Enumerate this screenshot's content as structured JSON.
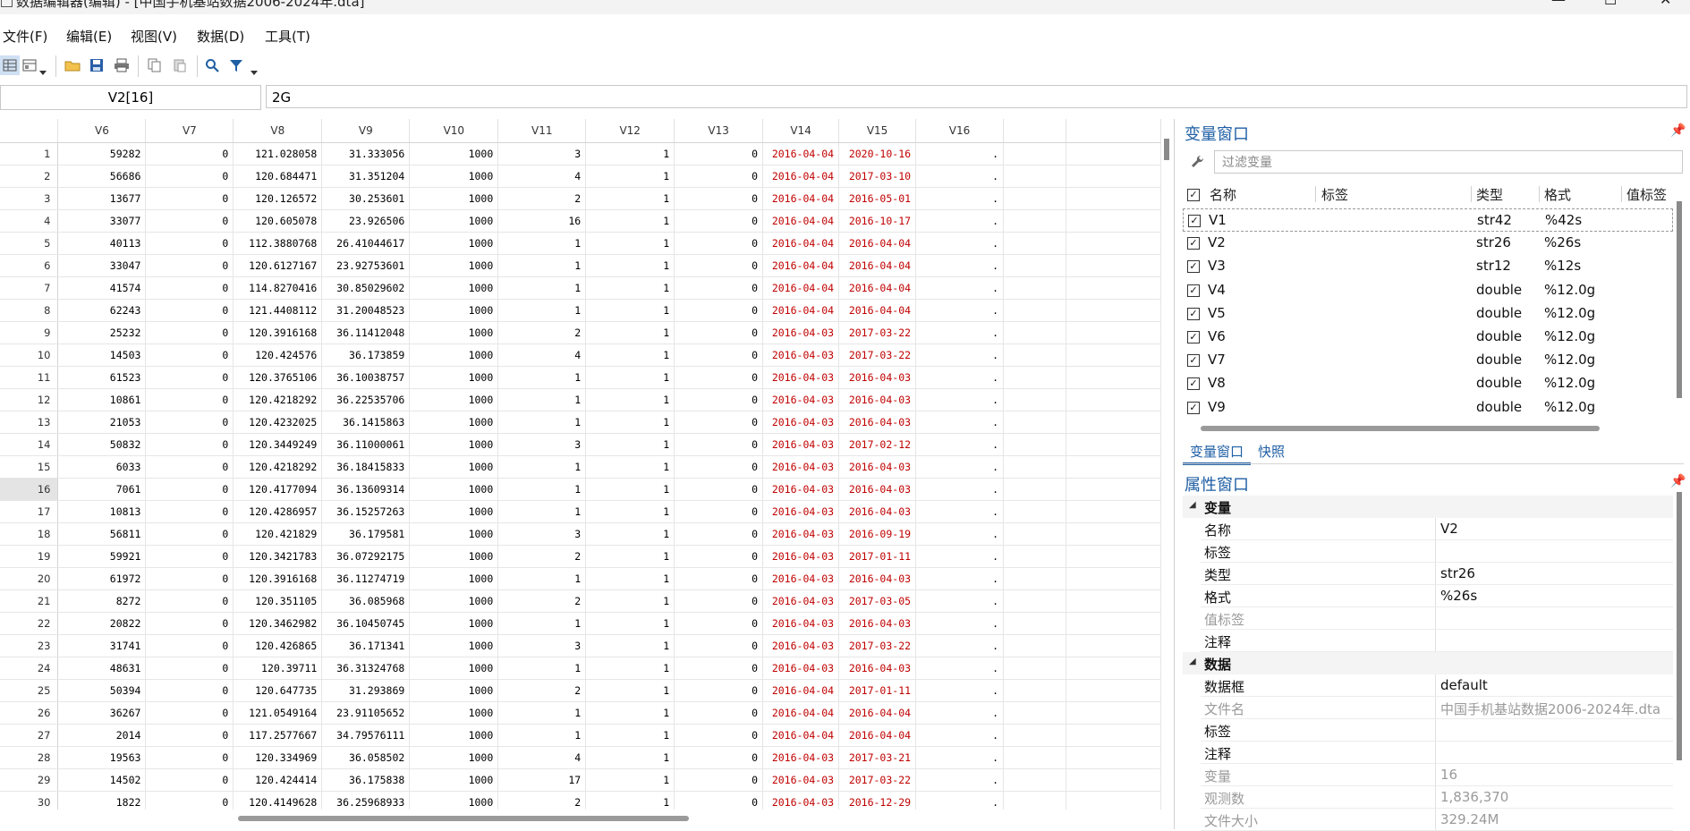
{
  "window": {
    "title": "数据编辑器(编辑) - [中国手机基站数据2006-2024年.dta]",
    "controls": {
      "minimize": "—",
      "maximize": "☐",
      "close": "✕"
    }
  },
  "menu": [
    "文件(F)",
    "编辑(E)",
    "视图(V)",
    "数据(D)",
    "工具(T)"
  ],
  "toolbar_icons": [
    "data-editor-icon",
    "variables-icon",
    "dropdown-arrow-icon",
    "open-folder-icon",
    "save-icon",
    "print-icon",
    "copy-icon",
    "paste-icon",
    "search-icon",
    "filter-icon",
    "dropdown-arrow-icon"
  ],
  "cell_reference": "V2[16]",
  "cell_value": "2G",
  "grid": {
    "columns": [
      "V6",
      "V7",
      "V8",
      "V9",
      "V10",
      "V11",
      "V12",
      "V13",
      "V14",
      "V15",
      "V16"
    ],
    "selected_row": 16,
    "rows": [
      [
        "59282",
        "0",
        "121.028058",
        "31.333056",
        "1000",
        "3",
        "1",
        "0",
        "2016-04-04",
        "2020-10-16",
        "."
      ],
      [
        "56686",
        "0",
        "120.684471",
        "31.351204",
        "1000",
        "4",
        "1",
        "0",
        "2016-04-04",
        "2017-03-10",
        "."
      ],
      [
        "13677",
        "0",
        "120.126572",
        "30.253601",
        "1000",
        "2",
        "1",
        "0",
        "2016-04-04",
        "2016-05-01",
        "."
      ],
      [
        "33077",
        "0",
        "120.605078",
        "23.926506",
        "1000",
        "16",
        "1",
        "0",
        "2016-04-04",
        "2016-10-17",
        "."
      ],
      [
        "40113",
        "0",
        "112.3880768",
        "26.41044617",
        "1000",
        "1",
        "1",
        "0",
        "2016-04-04",
        "2016-04-04",
        "."
      ],
      [
        "33047",
        "0",
        "120.6127167",
        "23.92753601",
        "1000",
        "1",
        "1",
        "0",
        "2016-04-04",
        "2016-04-04",
        "."
      ],
      [
        "41574",
        "0",
        "114.8270416",
        "30.85029602",
        "1000",
        "1",
        "1",
        "0",
        "2016-04-04",
        "2016-04-04",
        "."
      ],
      [
        "62243",
        "0",
        "121.4408112",
        "31.20048523",
        "1000",
        "1",
        "1",
        "0",
        "2016-04-04",
        "2016-04-04",
        "."
      ],
      [
        "25232",
        "0",
        "120.3916168",
        "36.11412048",
        "1000",
        "2",
        "1",
        "0",
        "2016-04-03",
        "2017-03-22",
        "."
      ],
      [
        "14503",
        "0",
        "120.424576",
        "36.173859",
        "1000",
        "4",
        "1",
        "0",
        "2016-04-03",
        "2017-03-22",
        "."
      ],
      [
        "61523",
        "0",
        "120.3765106",
        "36.10038757",
        "1000",
        "1",
        "1",
        "0",
        "2016-04-03",
        "2016-04-03",
        "."
      ],
      [
        "10861",
        "0",
        "120.4218292",
        "36.22535706",
        "1000",
        "1",
        "1",
        "0",
        "2016-04-03",
        "2016-04-03",
        "."
      ],
      [
        "21053",
        "0",
        "120.4232025",
        "36.1415863",
        "1000",
        "1",
        "1",
        "0",
        "2016-04-03",
        "2016-04-03",
        "."
      ],
      [
        "50832",
        "0",
        "120.3449249",
        "36.11000061",
        "1000",
        "3",
        "1",
        "0",
        "2016-04-03",
        "2017-02-12",
        "."
      ],
      [
        "6033",
        "0",
        "120.4218292",
        "36.18415833",
        "1000",
        "1",
        "1",
        "0",
        "2016-04-03",
        "2016-04-03",
        "."
      ],
      [
        "7061",
        "0",
        "120.4177094",
        "36.13609314",
        "1000",
        "1",
        "1",
        "0",
        "2016-04-03",
        "2016-04-03",
        "."
      ],
      [
        "10813",
        "0",
        "120.4286957",
        "36.15257263",
        "1000",
        "1",
        "1",
        "0",
        "2016-04-03",
        "2016-04-03",
        "."
      ],
      [
        "56811",
        "0",
        "120.421829",
        "36.179581",
        "1000",
        "3",
        "1",
        "0",
        "2016-04-03",
        "2016-09-19",
        "."
      ],
      [
        "59921",
        "0",
        "120.3421783",
        "36.07292175",
        "1000",
        "2",
        "1",
        "0",
        "2016-04-03",
        "2017-01-11",
        "."
      ],
      [
        "61972",
        "0",
        "120.3916168",
        "36.11274719",
        "1000",
        "1",
        "1",
        "0",
        "2016-04-03",
        "2016-04-03",
        "."
      ],
      [
        "8272",
        "0",
        "120.351105",
        "36.085968",
        "1000",
        "2",
        "1",
        "0",
        "2016-04-03",
        "2017-03-05",
        "."
      ],
      [
        "20822",
        "0",
        "120.3462982",
        "36.10450745",
        "1000",
        "1",
        "1",
        "0",
        "2016-04-03",
        "2016-04-03",
        "."
      ],
      [
        "31741",
        "0",
        "120.426865",
        "36.171341",
        "1000",
        "3",
        "1",
        "0",
        "2016-04-03",
        "2017-03-22",
        "."
      ],
      [
        "48631",
        "0",
        "120.39711",
        "36.31324768",
        "1000",
        "1",
        "1",
        "0",
        "2016-04-03",
        "2016-04-03",
        "."
      ],
      [
        "50394",
        "0",
        "120.647735",
        "31.293869",
        "1000",
        "2",
        "1",
        "0",
        "2016-04-04",
        "2017-01-11",
        "."
      ],
      [
        "36267",
        "0",
        "121.0549164",
        "23.91105652",
        "1000",
        "1",
        "1",
        "0",
        "2016-04-04",
        "2016-04-04",
        "."
      ],
      [
        "2014",
        "0",
        "117.2577667",
        "34.79576111",
        "1000",
        "1",
        "1",
        "0",
        "2016-04-04",
        "2016-04-04",
        "."
      ],
      [
        "19563",
        "0",
        "120.334969",
        "36.058502",
        "1000",
        "4",
        "1",
        "0",
        "2016-04-03",
        "2017-03-21",
        "."
      ],
      [
        "14502",
        "0",
        "120.424414",
        "36.175838",
        "1000",
        "17",
        "1",
        "0",
        "2016-04-03",
        "2017-03-22",
        "."
      ],
      [
        "1822",
        "0",
        "120.4149628",
        "36.25968933",
        "1000",
        "2",
        "1",
        "0",
        "2016-04-03",
        "2016-12-29",
        "."
      ]
    ]
  },
  "variables_panel": {
    "title": "变量窗口",
    "filter_placeholder": "过滤变量",
    "headers": {
      "name": "名称",
      "label": "标签",
      "type": "类型",
      "format": "格式",
      "value_label": "值标签"
    },
    "rows": [
      {
        "name": "V1",
        "type": "str42",
        "format": "%42s"
      },
      {
        "name": "V2",
        "type": "str26",
        "format": "%26s"
      },
      {
        "name": "V3",
        "type": "str12",
        "format": "%12s"
      },
      {
        "name": "V4",
        "type": "double",
        "format": "%12.0g"
      },
      {
        "name": "V5",
        "type": "double",
        "format": "%12.0g"
      },
      {
        "name": "V6",
        "type": "double",
        "format": "%12.0g"
      },
      {
        "name": "V7",
        "type": "double",
        "format": "%12.0g"
      },
      {
        "name": "V8",
        "type": "double",
        "format": "%12.0g"
      },
      {
        "name": "V9",
        "type": "double",
        "format": "%12.0g"
      }
    ],
    "tabs": [
      "变量窗口",
      "快照"
    ]
  },
  "properties_panel": {
    "title": "属性窗口",
    "sections": [
      {
        "title": "变量",
        "rows": [
          {
            "key": "名称",
            "value": "V2",
            "gray": false
          },
          {
            "key": "标签",
            "value": "",
            "gray": false
          },
          {
            "key": "类型",
            "value": "str26",
            "gray": false
          },
          {
            "key": "格式",
            "value": "%26s",
            "gray": false
          },
          {
            "key": "值标签",
            "value": "",
            "gray": true
          },
          {
            "key": "注释",
            "value": "",
            "gray": false
          }
        ]
      },
      {
        "title": "数据",
        "rows": [
          {
            "key": "数据框",
            "value": "default",
            "gray": false
          },
          {
            "key": "文件名",
            "value": "中国手机基站数据2006-2024年.dta",
            "gray": true
          },
          {
            "key": "标签",
            "value": "",
            "gray": false
          },
          {
            "key": "注释",
            "value": "",
            "gray": false
          },
          {
            "key": "变量",
            "value": "16",
            "gray": true
          },
          {
            "key": "观测数",
            "value": "1,836,370",
            "gray": true
          },
          {
            "key": "文件大小",
            "value": "329.24M",
            "gray": true
          }
        ]
      }
    ]
  },
  "colors": {
    "accent": "#1f5fa5",
    "date_text": "#c00000",
    "selected_row": "#e4e4e4"
  }
}
